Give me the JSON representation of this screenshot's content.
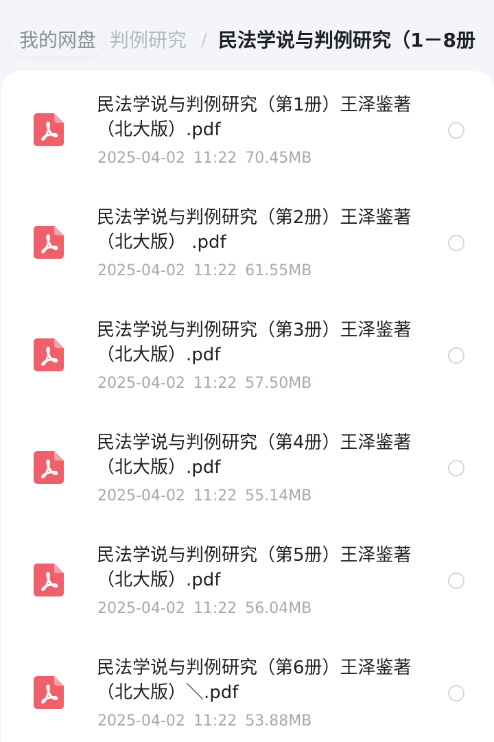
{
  "breadcrumb": {
    "root": "我的网盘",
    "middle": "判例研究",
    "separator": "/",
    "current": "民法学说与判例研究（1－8册"
  },
  "files": [
    {
      "name": "民法学说与判例研究（第1册）王泽鉴著 （北大版）.pdf",
      "date": "2025-04-02",
      "time": "11:22",
      "size": "70.45MB"
    },
    {
      "name": "民法学说与判例研究（第2册）王泽鉴著 （北大版） .pdf",
      "date": "2025-04-02",
      "time": "11:22",
      "size": "61.55MB"
    },
    {
      "name": "民法学说与判例研究（第3册）王泽鉴著 （北大版）.pdf",
      "date": "2025-04-02",
      "time": "11:22",
      "size": "57.50MB"
    },
    {
      "name": "民法学说与判例研究（第4册）王泽鉴著 （北大版）.pdf",
      "date": "2025-04-02",
      "time": "11:22",
      "size": "55.14MB"
    },
    {
      "name": "民法学说与判例研究（第5册）王泽鉴著 （北大版）.pdf",
      "date": "2025-04-02",
      "time": "11:22",
      "size": "56.04MB"
    },
    {
      "name": "民法学说与判例研究（第6册）王泽鉴著 （北大版）＼.pdf",
      "date": "2025-04-02",
      "time": "11:22",
      "size": "53.88MB"
    }
  ],
  "icons": {
    "file_type": "pdf-file-icon",
    "select": "radio-circle-icon"
  },
  "colors": {
    "pdf_icon": "#f0606a",
    "title_text": "#1c1f24",
    "meta_text": "#a4a9b2",
    "background": "#f3f5f9",
    "card": "#ffffff"
  }
}
